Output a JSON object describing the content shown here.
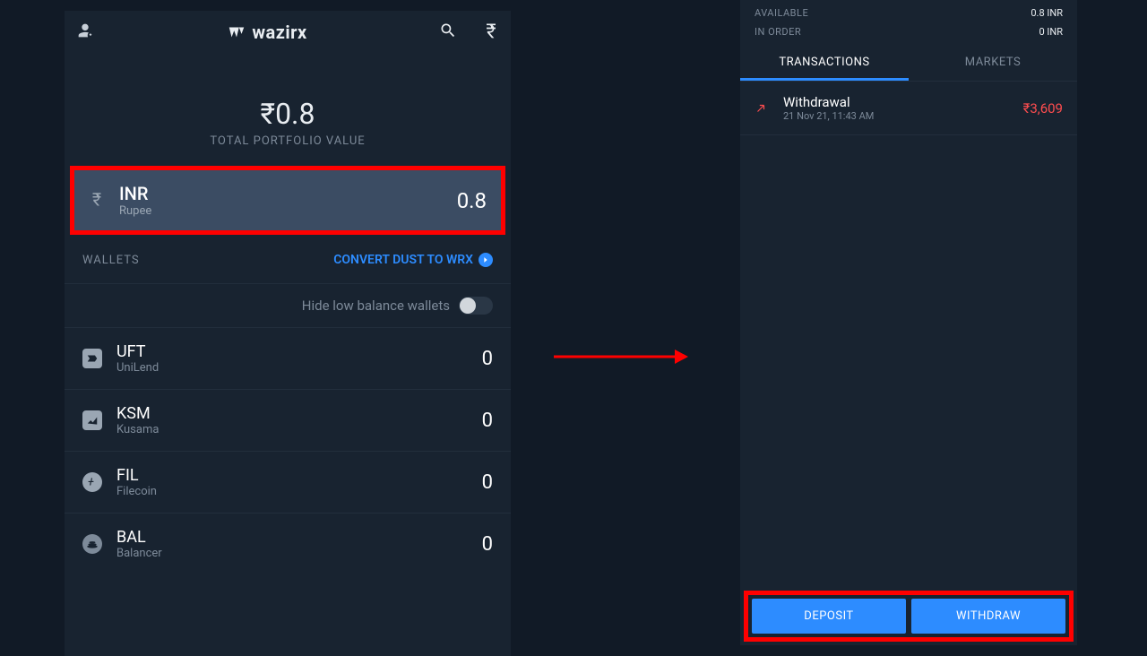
{
  "header": {
    "brand": "wazirx"
  },
  "portfolio": {
    "value": "₹0.8",
    "label": "TOTAL PORTFOLIO VALUE"
  },
  "inr": {
    "symbol": "INR",
    "name": "Rupee",
    "balance": "0.8"
  },
  "wallets_header": {
    "title": "WALLETS",
    "convert": "CONVERT DUST TO WRX"
  },
  "hide_low": {
    "label": "Hide low balance wallets"
  },
  "wallets": [
    {
      "symbol": "UFT",
      "name": "UniLend",
      "balance": "0"
    },
    {
      "symbol": "KSM",
      "name": "Kusama",
      "balance": "0"
    },
    {
      "symbol": "FIL",
      "name": "Filecoin",
      "balance": "0"
    },
    {
      "symbol": "BAL",
      "name": "Balancer",
      "balance": "0"
    }
  ],
  "right": {
    "available_lbl": "AVAILABLE",
    "available_val": "0.8 INR",
    "inorder_lbl": "IN ORDER",
    "inorder_val": "0 INR",
    "tab_tx": "TRANSACTIONS",
    "tab_mkt": "MARKETS"
  },
  "tx": {
    "type": "Withdrawal",
    "date": "21 Nov 21, 11:43 AM",
    "amount": "₹3,609"
  },
  "buttons": {
    "deposit": "DEPOSIT",
    "withdraw": "WITHDRAW"
  }
}
